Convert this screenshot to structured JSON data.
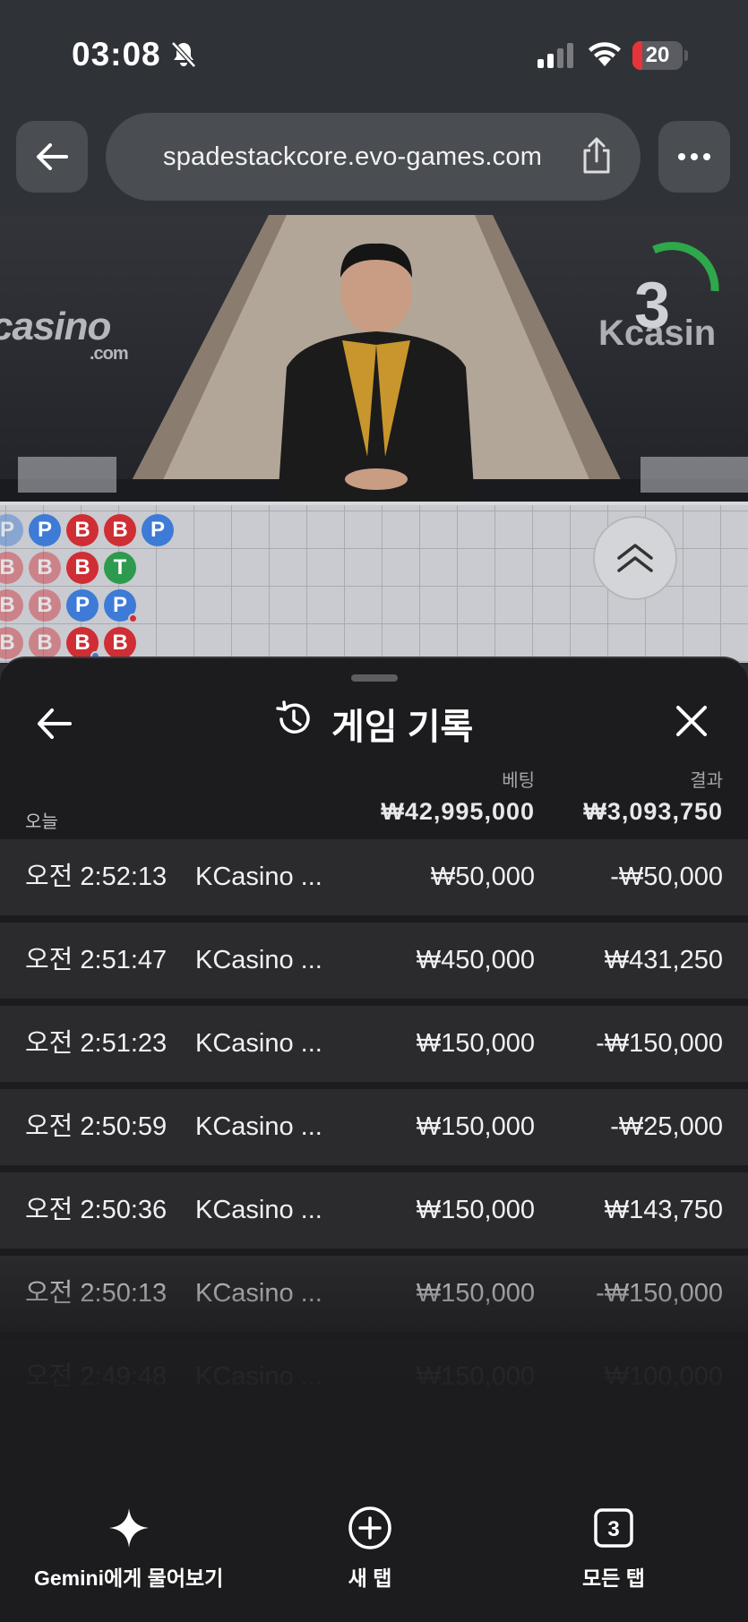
{
  "status_bar": {
    "time": "03:08",
    "battery": "20",
    "battery_level": 0.2,
    "battery_color": "#e5343a"
  },
  "browser": {
    "url": "spadestackcore.evo-games.com",
    "icons": [
      "back-arrow-icon",
      "share-icon",
      "more-icon"
    ]
  },
  "video": {
    "brand_left": "casino",
    "brand_left_sub": ".com",
    "brand_right": "Kcasin",
    "countdown": "3",
    "countdown_color": "#2ea84a"
  },
  "roadmap": {
    "rows": [
      [
        "P",
        "P",
        "B",
        "B",
        "P"
      ],
      [
        "B",
        "B",
        "B",
        "T"
      ],
      [
        "B",
        "B",
        "P",
        "P"
      ],
      [
        "B",
        "B",
        "B",
        "B"
      ]
    ],
    "colors": {
      "P": "#3d7bd6",
      "B": "#cf2e34",
      "T": "#2e9a4e"
    }
  },
  "history": {
    "title": "게임 기록",
    "bet_header": "베팅",
    "result_header": "결과",
    "today_label": "오늘",
    "total_bet": "₩42,995,000",
    "total_result": "₩3,093,750",
    "rows": [
      {
        "time": "오전 2:52:13",
        "game": "KCasino ...",
        "bet": "₩50,000",
        "result": "-₩50,000"
      },
      {
        "time": "오전 2:51:47",
        "game": "KCasino ...",
        "bet": "₩450,000",
        "result": "₩431,250"
      },
      {
        "time": "오전 2:51:23",
        "game": "KCasino ...",
        "bet": "₩150,000",
        "result": "-₩150,000"
      },
      {
        "time": "오전 2:50:59",
        "game": "KCasino ...",
        "bet": "₩150,000",
        "result": "-₩25,000"
      },
      {
        "time": "오전 2:50:36",
        "game": "KCasino ...",
        "bet": "₩150,000",
        "result": "₩143,750"
      },
      {
        "time": "오전 2:50:13",
        "game": "KCasino ...",
        "bet": "₩150,000",
        "result": "-₩150,000"
      },
      {
        "time": "오전 2:49:48",
        "game": "KCasino ...",
        "bet": "₩150,000",
        "result": "₩100,000"
      }
    ]
  },
  "bottom_bar": {
    "gemini": "Gemini에게 물어보기",
    "new_tab": "새 탭",
    "all_tabs": "모든 탭",
    "tab_count": "3"
  }
}
